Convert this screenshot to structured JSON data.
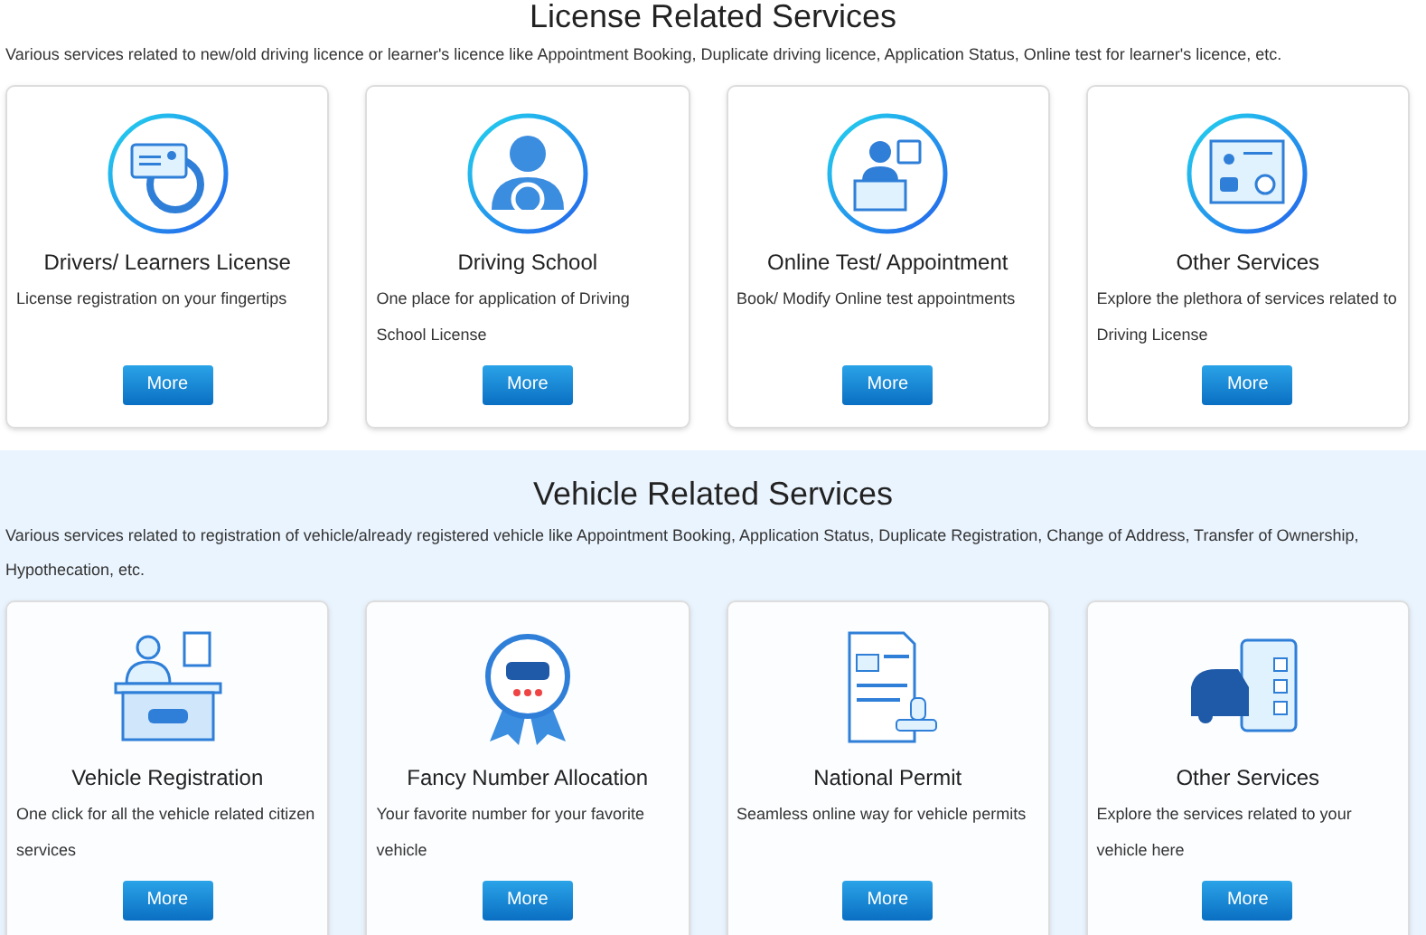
{
  "sections": [
    {
      "title": "License Related Services",
      "description": "Various services related to new/old driving licence or learner's licence like Appointment Booking, Duplicate driving licence, Application Status, Online test for learner's licence, etc.",
      "shaded": false,
      "cards": [
        {
          "title": "Drivers/ Learners License",
          "text": "License registration on your fingertips",
          "button": "More"
        },
        {
          "title": "Driving School",
          "text": "One place for application of Driving School License",
          "button": "More"
        },
        {
          "title": "Online Test/ Appointment",
          "text": "Book/ Modify Online test appointments",
          "button": "More"
        },
        {
          "title": "Other Services",
          "text": "Explore the plethora of services related to Driving License",
          "button": "More"
        }
      ]
    },
    {
      "title": "Vehicle Related Services",
      "description": "Various services related to registration of vehicle/already registered vehicle like Appointment Booking, Application Status, Duplicate Registration, Change of Address, Transfer of Ownership, Hypothecation, etc.",
      "shaded": true,
      "cards": [
        {
          "title": "Vehicle Registration",
          "text": "One click for all the vehicle related citizen services",
          "button": "More"
        },
        {
          "title": "Fancy Number Allocation",
          "text": "Your favorite number for your favorite vehicle",
          "button": "More"
        },
        {
          "title": "National Permit",
          "text": "Seamless online way for vehicle permits",
          "button": "More"
        },
        {
          "title": "Other Services",
          "text": "Explore the services related to your vehicle here",
          "button": "More"
        }
      ]
    }
  ]
}
